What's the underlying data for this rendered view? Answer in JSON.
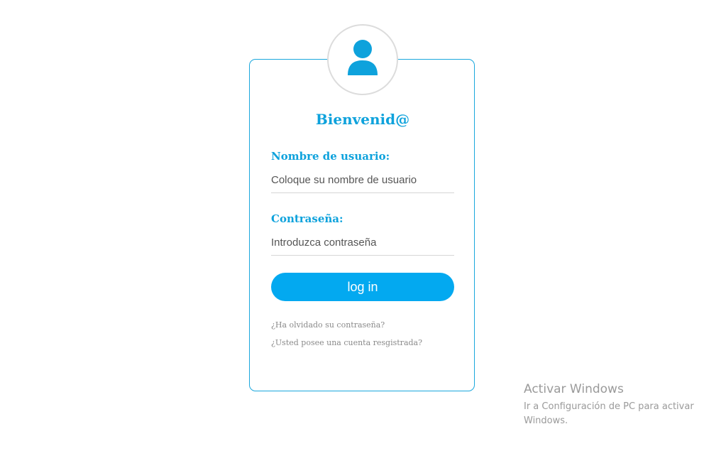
{
  "login": {
    "avatar_icon": "user-icon",
    "title": "Bienvenid@",
    "username": {
      "label": "Nombre de usuario:",
      "placeholder": "Coloque su nombre de usuario",
      "value": ""
    },
    "password": {
      "label": "Contraseña:",
      "placeholder": "Introduzca contraseña",
      "value": ""
    },
    "submit_label": "log in",
    "forgot_link": "¿Ha olvidado su contraseña?",
    "register_link": "¿Usted posee una cuenta resgistrada?"
  },
  "watermark": {
    "title": "Activar Windows",
    "subtitle": "Ir a Configuración de PC para activar Windows."
  },
  "colors": {
    "accent": "#03a9f0",
    "border": "#1aa7dd",
    "label": "#0ea2dc"
  }
}
